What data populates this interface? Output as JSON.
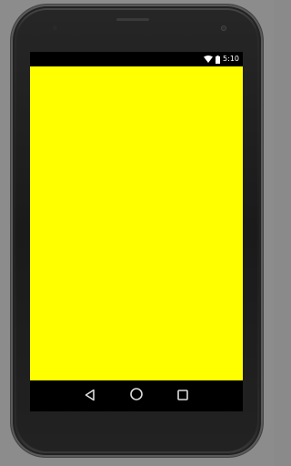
{
  "device": {
    "frame_icon": "android-phone-frame",
    "screen_background_color": "#ffff00",
    "bar_color": "#000000"
  },
  "status_bar": {
    "time": "5:10",
    "icons": [
      "wifi-icon",
      "battery-icon"
    ]
  },
  "navigation_bar": {
    "buttons": [
      {
        "name": "back",
        "icon": "back-triangle-icon"
      },
      {
        "name": "home",
        "icon": "home-circle-icon"
      },
      {
        "name": "recents",
        "icon": "recents-square-icon"
      }
    ]
  }
}
